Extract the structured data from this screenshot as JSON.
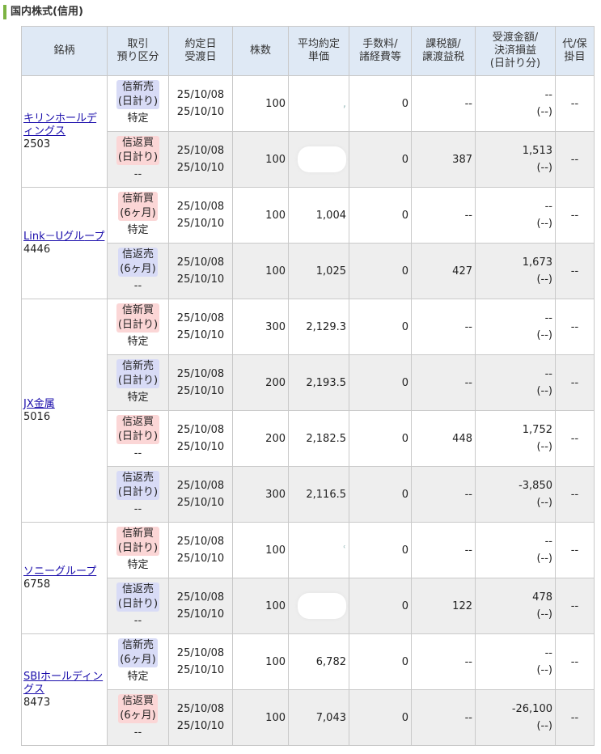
{
  "section": {
    "title": "国内株式(信用)"
  },
  "headers": {
    "meigara": "銘柄",
    "torihiki": [
      "取引",
      "預り区分"
    ],
    "yakujo": [
      "約定日",
      "受渡日"
    ],
    "kabusu": "株数",
    "heikin": [
      "平均約定",
      "単価"
    ],
    "tesuryo": [
      "手数料/",
      "諸経費等"
    ],
    "kazei": [
      "課税額/",
      "譲渡益税"
    ],
    "ukewatashi": [
      "受渡金額/",
      "決済損益",
      "(日計り分)"
    ],
    "dai": [
      "代/保",
      "掛目"
    ]
  },
  "stocks": [
    {
      "name": "キリンホールディングス",
      "name_lines": [
        "キリンホールデ",
        "ィングス"
      ],
      "code": "2503",
      "rows": [
        {
          "kind": "sell",
          "trade": "信新売",
          "term": "(日計り)",
          "account": "特定",
          "yakujo": "25/10/08",
          "ukewatashi": "25/10/10",
          "qty": "100",
          "price": "",
          "fee": "0",
          "tax": "--",
          "amount": "--",
          "pl": "(--)",
          "dai": "--",
          "masked": false,
          "price_trace": ","
        },
        {
          "kind": "buy",
          "trade": "信返買",
          "term": "(日計り)",
          "account": "--",
          "yakujo": "25/10/08",
          "ukewatashi": "25/10/10",
          "qty": "100",
          "price": "",
          "fee": "0",
          "tax": "387",
          "amount": "1,513",
          "pl": "(--)",
          "dai": "--",
          "masked": true
        }
      ]
    },
    {
      "name": "Link－Uグループ",
      "name_lines": [
        "Link－Uグル",
        "ープ"
      ],
      "code": "4446",
      "rows": [
        {
          "kind": "buy",
          "trade": "信新買",
          "term": "(6ヶ月)",
          "account": "特定",
          "yakujo": "25/10/08",
          "ukewatashi": "25/10/10",
          "qty": "100",
          "price": "1,004",
          "fee": "0",
          "tax": "--",
          "amount": "--",
          "pl": "(--)",
          "dai": "--",
          "masked": false
        },
        {
          "kind": "sell",
          "trade": "信返売",
          "term": "(6ヶ月)",
          "account": "--",
          "yakujo": "25/10/08",
          "ukewatashi": "25/10/10",
          "qty": "100",
          "price": "1,025",
          "fee": "0",
          "tax": "427",
          "amount": "1,673",
          "pl": "(--)",
          "dai": "--",
          "masked": false
        }
      ]
    },
    {
      "name": "JX金属",
      "name_lines": [
        "JX金属"
      ],
      "code": "5016",
      "rows": [
        {
          "kind": "buy",
          "trade": "信新買",
          "term": "(日計り)",
          "account": "特定",
          "yakujo": "25/10/08",
          "ukewatashi": "25/10/10",
          "qty": "300",
          "price": "2,129.3",
          "fee": "0",
          "tax": "--",
          "amount": "--",
          "pl": "(--)",
          "dai": "--",
          "masked": false
        },
        {
          "kind": "sell",
          "trade": "信新売",
          "term": "(日計り)",
          "account": "特定",
          "yakujo": "25/10/08",
          "ukewatashi": "25/10/10",
          "qty": "200",
          "price": "2,193.5",
          "fee": "0",
          "tax": "--",
          "amount": "--",
          "pl": "(--)",
          "dai": "--",
          "masked": false
        },
        {
          "kind": "buy",
          "trade": "信返買",
          "term": "(日計り)",
          "account": "--",
          "yakujo": "25/10/08",
          "ukewatashi": "25/10/10",
          "qty": "200",
          "price": "2,182.5",
          "fee": "0",
          "tax": "448",
          "amount": "1,752",
          "pl": "(--)",
          "dai": "--",
          "masked": false
        },
        {
          "kind": "sell",
          "trade": "信返売",
          "term": "(日計り)",
          "account": "--",
          "yakujo": "25/10/08",
          "ukewatashi": "25/10/10",
          "qty": "300",
          "price": "2,116.5",
          "fee": "0",
          "tax": "--",
          "amount": "-3,850",
          "pl": "(--)",
          "dai": "--",
          "masked": false
        }
      ]
    },
    {
      "name": "ソニーグループ",
      "name_lines": [
        "ソニーグループ"
      ],
      "code": "6758",
      "rows": [
        {
          "kind": "buy",
          "trade": "信新買",
          "term": "(日計り)",
          "account": "特定",
          "yakujo": "25/10/08",
          "ukewatashi": "25/10/10",
          "qty": "100",
          "price": "",
          "fee": "0",
          "tax": "--",
          "amount": "--",
          "pl": "(--)",
          "dai": "--",
          "masked": false,
          "price_trace": "ʿ"
        },
        {
          "kind": "sell",
          "trade": "信返売",
          "term": "(日計り)",
          "account": "--",
          "yakujo": "25/10/08",
          "ukewatashi": "25/10/10",
          "qty": "100",
          "price": "",
          "fee": "0",
          "tax": "122",
          "amount": "478",
          "pl": "(--)",
          "dai": "--",
          "masked": true
        }
      ]
    },
    {
      "name": "SBIホールディングス",
      "name_lines": [
        "SBIホールディ",
        "ングス"
      ],
      "code": "8473",
      "rows": [
        {
          "kind": "sell",
          "trade": "信新売",
          "term": "(6ヶ月)",
          "account": "特定",
          "yakujo": "25/10/08",
          "ukewatashi": "25/10/10",
          "qty": "100",
          "price": "6,782",
          "fee": "0",
          "tax": "--",
          "amount": "--",
          "pl": "(--)",
          "dai": "--",
          "masked": false
        },
        {
          "kind": "buy",
          "trade": "信返買",
          "term": "(6ヶ月)",
          "account": "--",
          "yakujo": "25/10/08",
          "ukewatashi": "25/10/10",
          "qty": "100",
          "price": "7,043",
          "fee": "0",
          "tax": "--",
          "amount": "-26,100",
          "pl": "(--)",
          "dai": "--",
          "masked": false
        }
      ]
    }
  ]
}
